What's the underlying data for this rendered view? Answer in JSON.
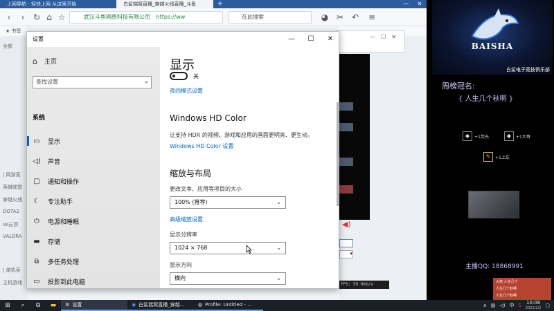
{
  "browser": {
    "tabs": [
      {
        "label": "上网导航 - 轻快上网 从这里开始"
      },
      {
        "label": "白鲨揣窝直播_穿越火线直播_斗鱼"
      }
    ],
    "new_tab": "+",
    "address_site": "武汉斗鱼网络科技有限公司",
    "address_url": "https://ww",
    "search_placeholder": "在此搜索",
    "bookmarks_label": "书签",
    "side_items": [
      "全部",
      "| 网游竞",
      "英雄联盟",
      "穿越火线",
      "DOTA2",
      "lol云顶",
      "VALORA",
      "| 单机竞",
      "主机游戏"
    ],
    "player_status": "FPS: 59   0kb/s"
  },
  "settings": {
    "window_title": "设置",
    "controls": {
      "minimize": "—",
      "maximize": "☐",
      "close": "✕"
    },
    "home": "主页",
    "search_placeholder": "查找设置",
    "section": "系统",
    "nav_items": [
      {
        "label": "显示",
        "icon": "monitor-icon",
        "glyph": "▭",
        "selected": true
      },
      {
        "label": "声音",
        "icon": "speaker-icon",
        "glyph": "◁)",
        "selected": false
      },
      {
        "label": "通知和操作",
        "icon": "notification-icon",
        "glyph": "▢",
        "selected": false
      },
      {
        "label": "专注助手",
        "icon": "moon-icon",
        "glyph": "☾",
        "selected": false
      },
      {
        "label": "电源和睡眠",
        "icon": "power-icon",
        "glyph": "⏻",
        "selected": false
      },
      {
        "label": "存储",
        "icon": "storage-icon",
        "glyph": "▬",
        "selected": false
      },
      {
        "label": "多任务处理",
        "icon": "multitask-icon",
        "glyph": "⧉",
        "selected": false
      },
      {
        "label": "投影到此电脑",
        "icon": "project-icon",
        "glyph": "▭",
        "selected": false
      },
      {
        "label": "体验共享",
        "icon": "share-icon",
        "glyph": "✕",
        "selected": false
      }
    ],
    "main": {
      "title": "显示",
      "night_light_state": "关",
      "night_light_link": "夜间模式设置",
      "hdr_heading": "Windows HD Color",
      "hdr_desc": "让支持 HDR 的视频、游戏和应用的画面更明亮、更生动。",
      "hdr_link": "Windows HD Color 设置",
      "scale_heading": "缩放与布局",
      "scale_label": "更改文本、应用等项目的大小",
      "scale_value": "100% (推荐)",
      "advanced_link": "高级缩放设置",
      "resolution_label": "显示分辨率",
      "resolution_value": "1024 × 768",
      "orientation_label": "显示方向",
      "orientation_value": "横向"
    }
  },
  "overlay": {
    "logo_text": "BAISHA",
    "logo_caption": "白鲨电子竞技俱乐部",
    "rank_title": "周榜冠名:",
    "rank_name": "{ 人生几个秋啊 }",
    "gifts": [
      {
        "label": "+1荧光",
        "icon": "gift-icon"
      },
      {
        "label": "+1大哥",
        "icon": "gift-icon"
      },
      {
        "label": "+1上车",
        "icon": "gift-icon"
      }
    ],
    "qq_label": "主播QQ:",
    "qq_number": "18868991",
    "promo": [
      "火箭 人生几个",
      "人生几个秋啊",
      "人生几个秋啊"
    ]
  },
  "taskbar": {
    "start_icon": "windows-icon",
    "settings_task": "设置",
    "browser_task": "白鲨揣窝直播_穿越...",
    "obs_task": "Profile: Untitled - ...",
    "ime": "中",
    "time": "10:06",
    "date": "2021/2/2"
  },
  "colors": {
    "accent": "#0067c0",
    "browser_tab_bar": "#2b5c9e",
    "overlay_text": "#c7bdf5"
  }
}
